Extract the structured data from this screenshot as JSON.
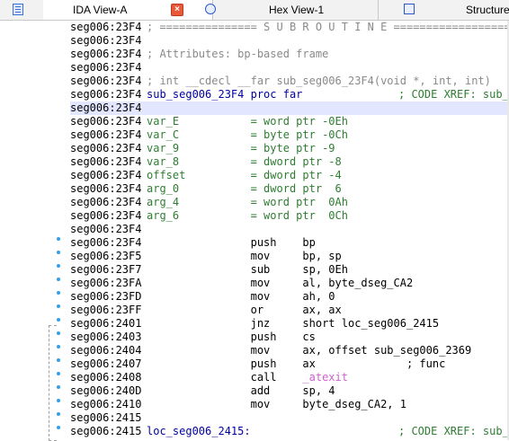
{
  "tabs": {
    "ida_view": "IDA View-A",
    "close_glyph": "×",
    "hex_view": "Hex View-1",
    "structures": "Structure"
  },
  "colors": {
    "address": "#000000",
    "comment": "#8a8a8a",
    "subroutine": "#0000a0",
    "local_var": "#2e7d32",
    "imported_func": "#d060d0",
    "selection": "#e3e6ff"
  },
  "icons": {
    "left_panel": "listing-icon",
    "hex": "hex-icon",
    "structures": "struct-icon"
  },
  "lines": [
    {
      "addr": "seg006:23F4",
      "text": "; =============== S U B R O U T I N E =======================================",
      "kind": "cmt"
    },
    {
      "addr": "seg006:23F4",
      "text": "",
      "kind": "plain"
    },
    {
      "addr": "seg006:23F4",
      "text": "; Attributes: bp-based frame",
      "kind": "cmt"
    },
    {
      "addr": "seg006:23F4",
      "text": "",
      "kind": "plain"
    },
    {
      "addr": "seg006:23F4",
      "text": "; int __cdecl __far sub_seg006_23F4(void *, int, int)",
      "kind": "cmt"
    },
    {
      "addr": "seg006:23F4",
      "text": "sub_seg006_23F4 proc far",
      "kind": "proc",
      "xref": "; CODE XREF: sub_s"
    },
    {
      "addr": "seg006:23F4",
      "text": "",
      "kind": "sel"
    },
    {
      "addr": "seg006:23F4",
      "text": "var_E           = word ptr -0Eh",
      "kind": "var"
    },
    {
      "addr": "seg006:23F4",
      "text": "var_C           = byte ptr -0Ch",
      "kind": "var"
    },
    {
      "addr": "seg006:23F4",
      "text": "var_9           = byte ptr -9",
      "kind": "var"
    },
    {
      "addr": "seg006:23F4",
      "text": "var_8           = dword ptr -8",
      "kind": "var"
    },
    {
      "addr": "seg006:23F4",
      "text": "offset          = dword ptr -4",
      "kind": "var"
    },
    {
      "addr": "seg006:23F4",
      "text": "arg_0           = dword ptr  6",
      "kind": "var"
    },
    {
      "addr": "seg006:23F4",
      "text": "arg_4           = word ptr  0Ah",
      "kind": "var"
    },
    {
      "addr": "seg006:23F4",
      "text": "arg_6           = word ptr  0Ch",
      "kind": "var"
    },
    {
      "addr": "seg006:23F4",
      "text": "",
      "kind": "plain"
    },
    {
      "addr": "seg006:23F4",
      "text": "                push    bp",
      "kind": "plain"
    },
    {
      "addr": "seg006:23F5",
      "text": "                mov     bp, sp",
      "kind": "plain"
    },
    {
      "addr": "seg006:23F7",
      "text": "                sub     sp, 0Eh",
      "kind": "plain"
    },
    {
      "addr": "seg006:23FA",
      "text": "                mov     al, byte_dseg_CA2",
      "kind": "plain"
    },
    {
      "addr": "seg006:23FD",
      "text": "                mov     ah, 0",
      "kind": "plain"
    },
    {
      "addr": "seg006:23FF",
      "text": "                or      ax, ax",
      "kind": "plain"
    },
    {
      "addr": "seg006:2401",
      "text": "                jnz     short loc_seg006_2415",
      "kind": "plain"
    },
    {
      "addr": "seg006:2403",
      "text": "                push    cs",
      "kind": "plain"
    },
    {
      "addr": "seg006:2404",
      "text": "                mov     ax, offset sub_seg006_2369",
      "kind": "plain"
    },
    {
      "addr": "seg006:2407",
      "text": "                push    ax              ; func",
      "kind": "plain"
    },
    {
      "addr": "seg006:2408",
      "text": "                call    ",
      "kind": "call",
      "target": "_atexit"
    },
    {
      "addr": "seg006:240D",
      "text": "                add     sp, 4",
      "kind": "plain"
    },
    {
      "addr": "seg006:2410",
      "text": "                mov     byte_dseg_CA2, 1",
      "kind": "plain"
    },
    {
      "addr": "seg006:2415",
      "text": "",
      "kind": "plain"
    },
    {
      "addr": "seg006:2415",
      "text": "loc_seg006_2415:",
      "kind": "proc",
      "xref": "; CODE XREF: sub_s"
    }
  ]
}
